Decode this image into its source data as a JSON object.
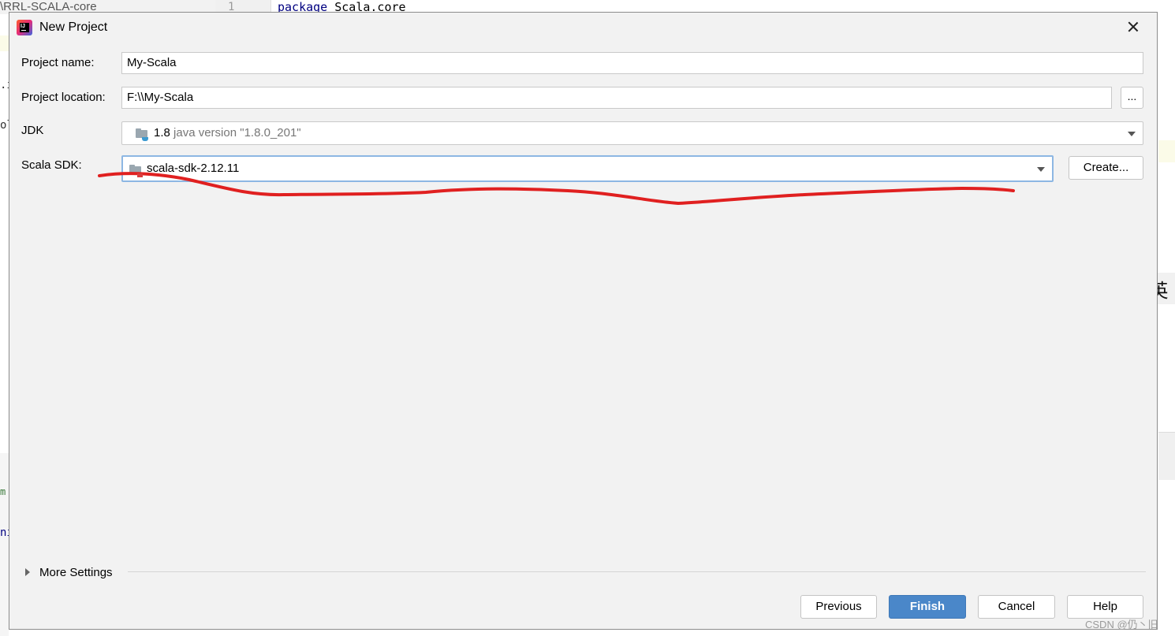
{
  "background": {
    "project_tree_text": "\\RRL-SCALA-core",
    "line_number": "1",
    "code_keyword": "package",
    "code_rest": "Scala.core",
    "fragments": [
      ".i",
      "ol",
      "m",
      "ni"
    ],
    "ime_indicator": "英",
    "watermark": "CSDN @仍丶旧"
  },
  "dialog": {
    "title": "New Project",
    "app_icon": "intellij-idea-icon",
    "close_icon": "close-icon",
    "project_name": {
      "label": "Project name:",
      "value": "My-Scala"
    },
    "project_location": {
      "label": "Project location:",
      "value": "F:\\\\My-Scala",
      "browse_label": "..."
    },
    "jdk": {
      "label": "JDK",
      "version": "1.8",
      "detail": "java version \"1.8.0_201\""
    },
    "scala_sdk": {
      "label": "Scala SDK:",
      "value": "scala-sdk-2.12.11",
      "create_label": "Create..."
    },
    "more_settings": "More Settings",
    "buttons": {
      "previous": "Previous",
      "finish": "Finish",
      "cancel": "Cancel",
      "help": "Help"
    }
  },
  "annotation": {
    "color": "#e02020",
    "type": "freehand-underline"
  }
}
